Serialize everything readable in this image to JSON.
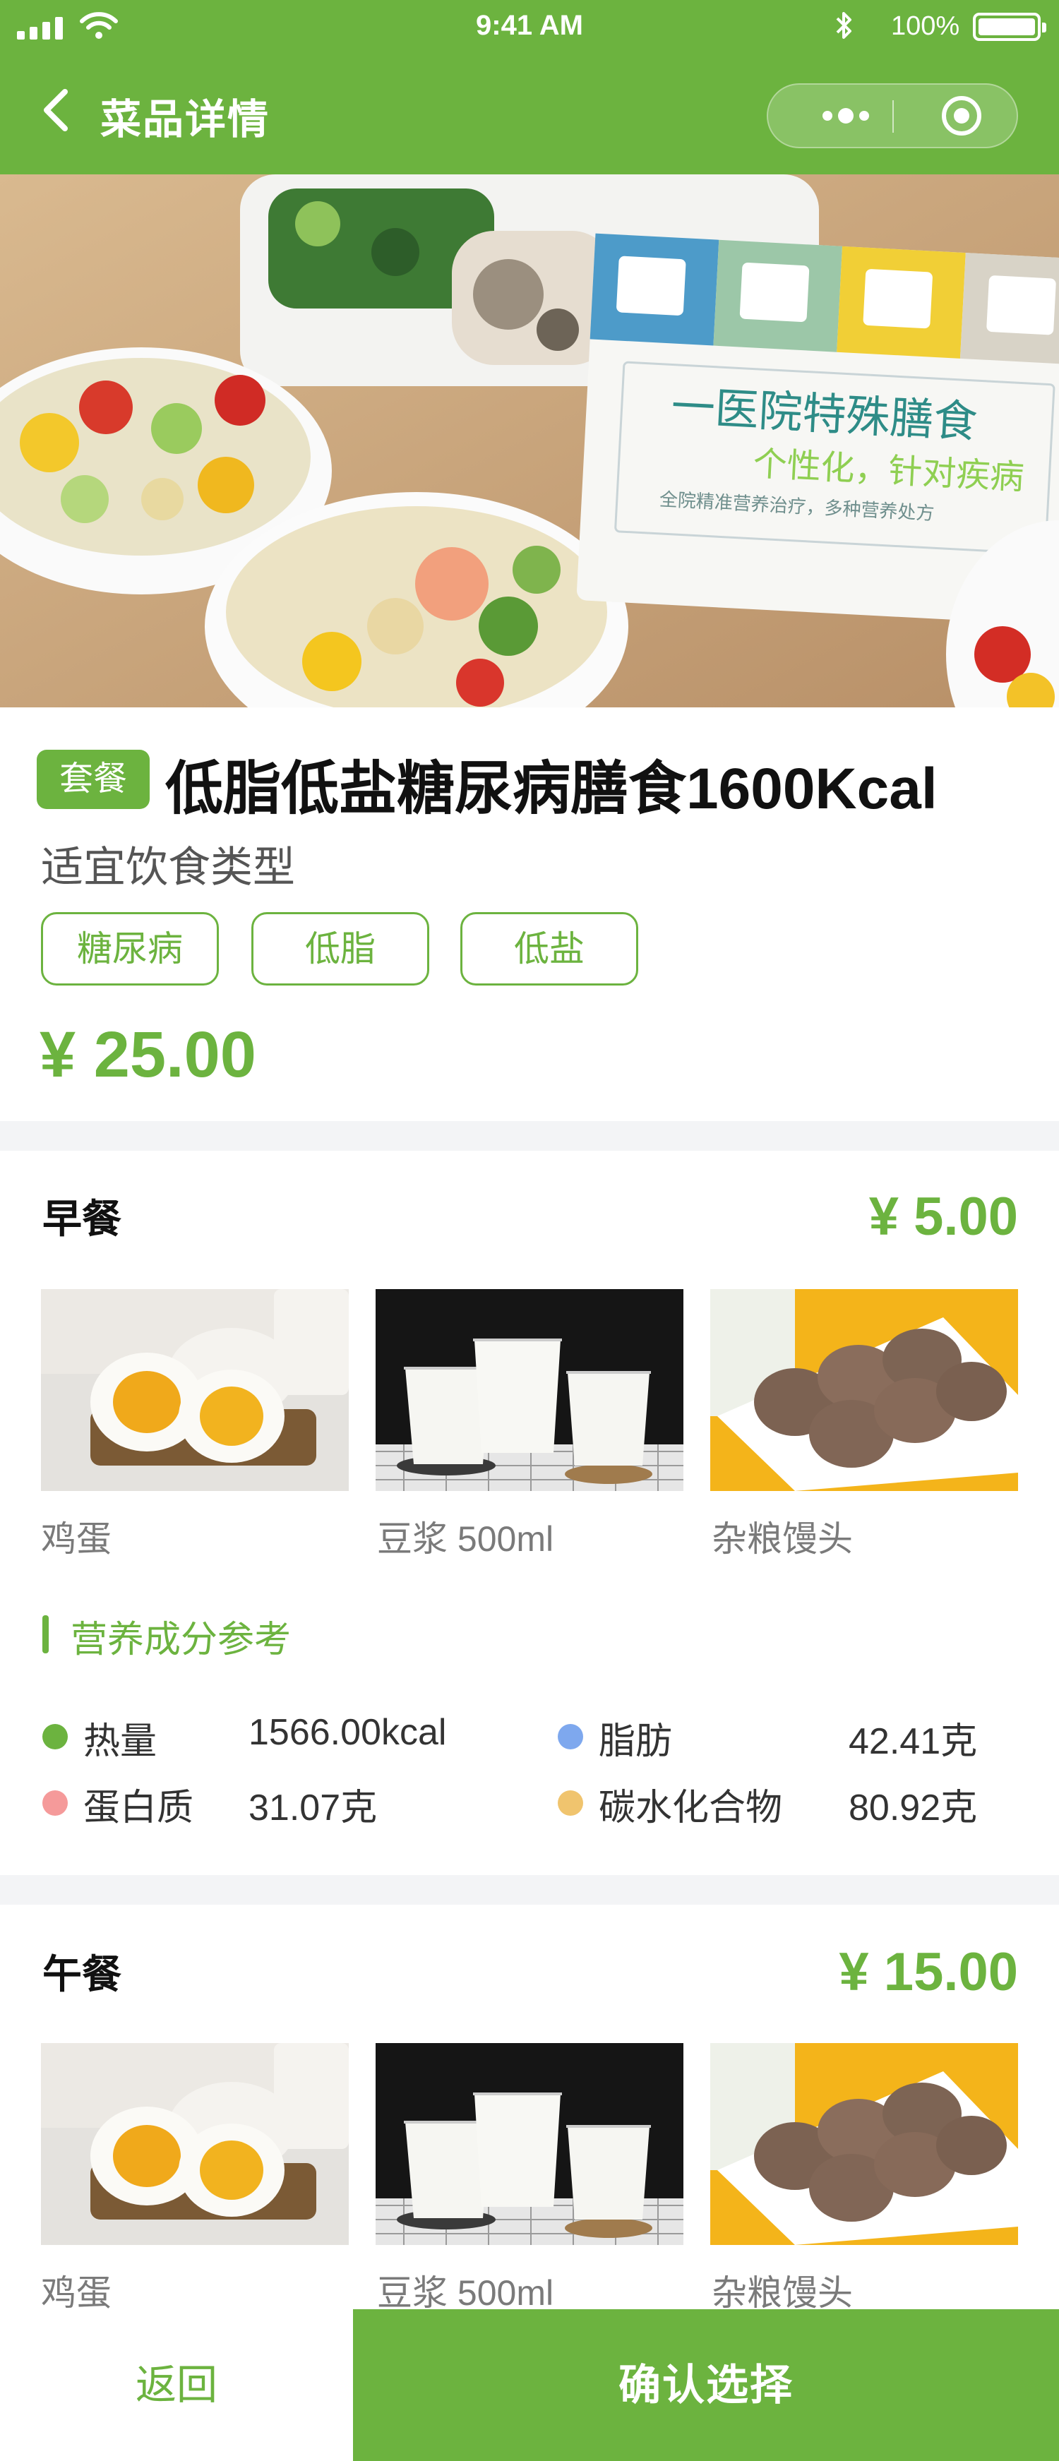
{
  "status_bar": {
    "time": "9:41 AM",
    "battery": "100%"
  },
  "nav": {
    "title": "菜品详情"
  },
  "dish": {
    "badge": "套餐",
    "title": "低脂低盐糖尿病膳食1600Kcal",
    "diet_type_label": "适宜饮食类型",
    "tags": [
      "糖尿病",
      "低脂",
      "低盐"
    ],
    "price": "¥ 25.00"
  },
  "hero": {
    "card_title": "一医院特殊膳食",
    "card_subtitle": "个性化，针对疾病",
    "card_caption": "全院精准营养治疗，多种营养处方"
  },
  "breakfast": {
    "title": "早餐",
    "price": "¥ 5.00",
    "items": [
      {
        "name": "鸡蛋"
      },
      {
        "name": "豆浆 500ml"
      },
      {
        "name": "杂粮馒头"
      }
    ],
    "nutrition": {
      "heading": "营养成分参考",
      "items": [
        {
          "label": "热量",
          "value": "1566.00kcal",
          "color": "#6cb33f"
        },
        {
          "label": "脂肪",
          "value": "42.41克",
          "color": "#7ea8ee"
        },
        {
          "label": "蛋白质",
          "value": "31.07克",
          "color": "#f59a9a"
        },
        {
          "label": "碳水化合物",
          "value": "80.92克",
          "color": "#f0c46e"
        }
      ]
    }
  },
  "lunch": {
    "title": "午餐",
    "price": "¥ 15.00",
    "items": [
      {
        "name": "鸡蛋"
      },
      {
        "name": "豆浆 500ml"
      },
      {
        "name": "杂粮馒头"
      }
    ]
  },
  "bottom_bar": {
    "back_label": "返回",
    "confirm_label": "确认选择"
  },
  "colors": {
    "accent": "#6cb33f",
    "section_bg": "#f3f4f6"
  }
}
